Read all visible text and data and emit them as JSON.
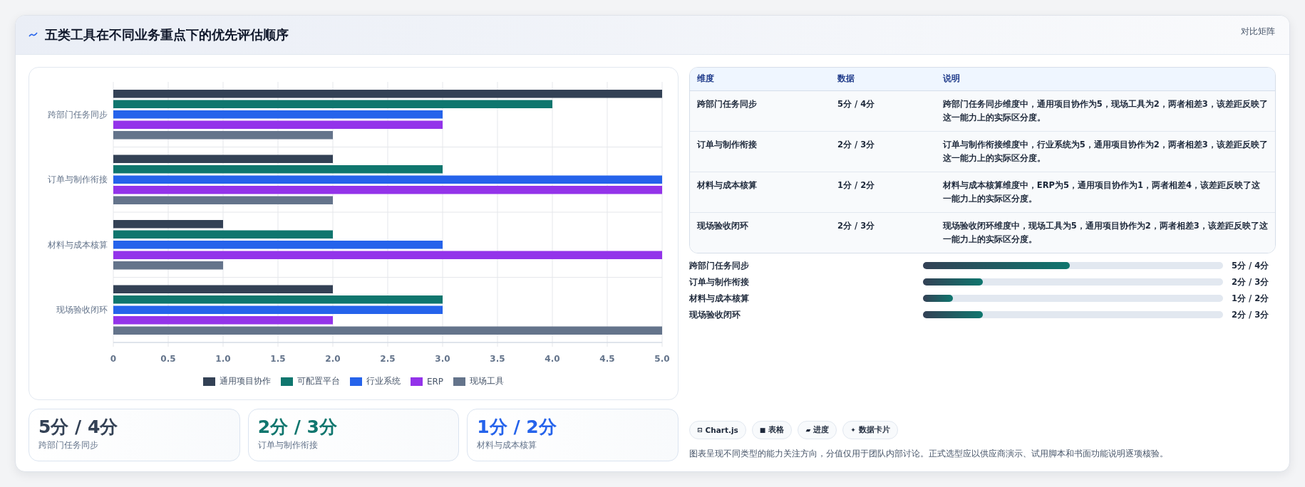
{
  "header": {
    "title": "五类工具在不同业务重点下的优先评估顺序",
    "action": "对比矩阵"
  },
  "chart": {
    "chart_data": {
      "type": "bar",
      "orientation": "horizontal",
      "categories": [
        "跨部门任务同步",
        "订单与制作衔接",
        "材料与成本核算",
        "现场验收闭环"
      ],
      "series": [
        {
          "name": "通用项目协作",
          "color": "#334155",
          "values": [
            5,
            2,
            1,
            2
          ]
        },
        {
          "name": "可配置平台",
          "color": "#0f766e",
          "values": [
            4,
            3,
            2,
            3
          ]
        },
        {
          "name": "行业系统",
          "color": "#2563eb",
          "values": [
            3,
            5,
            3,
            3
          ]
        },
        {
          "name": "ERP",
          "color": "#9333ea",
          "values": [
            3,
            5,
            5,
            2
          ]
        },
        {
          "name": "现场工具",
          "color": "#64748b",
          "values": [
            2,
            2,
            1,
            5
          ]
        }
      ],
      "xlim": [
        0,
        5
      ],
      "grid": true,
      "xticks": [
        {
          "value": 0,
          "label": "0"
        },
        {
          "value": 0.5,
          "label": "0.5"
        },
        {
          "value": 1,
          "label": "1.0"
        },
        {
          "value": 1.5,
          "label": "1.5"
        },
        {
          "value": 2,
          "label": "2.0"
        },
        {
          "value": 2.5,
          "label": "2.5"
        },
        {
          "value": 3,
          "label": "3.0"
        },
        {
          "value": 3.5,
          "label": "3.5"
        },
        {
          "value": 4,
          "label": "4.0"
        },
        {
          "value": 4.5,
          "label": "4.5"
        },
        {
          "value": 5,
          "label": "5.0"
        }
      ]
    }
  },
  "stats": [
    {
      "value": "5分 / 4分",
      "label": "跨部门任务同步",
      "color": "#334155"
    },
    {
      "value": "2分 / 3分",
      "label": "订单与制作衔接",
      "color": "#0f766e"
    },
    {
      "value": "1分 / 2分",
      "label": "材料与成本核算",
      "color": "#2563eb"
    }
  ],
  "table": {
    "columns": [
      "维度",
      "数据",
      "说明"
    ],
    "rows": [
      [
        "跨部门任务同步",
        "5分 / 4分",
        "跨部门任务同步维度中，通用项目协作为5，现场工具为2，两者相差3，该差距反映了这一能力上的实际区分度。"
      ],
      [
        "订单与制作衔接",
        "2分 / 3分",
        "订单与制作衔接维度中，行业系统为5，通用项目协作为2，两者相差3，该差距反映了这一能力上的实际区分度。"
      ],
      [
        "材料与成本核算",
        "1分 / 2分",
        "材料与成本核算维度中，ERP为5，通用项目协作为1，两者相差4，该差距反映了这一能力上的实际区分度。"
      ],
      [
        "现场验收闭环",
        "2分 / 3分",
        "现场验收闭环维度中，现场工具为5，通用项目协作为2，两者相差3，该差距反映了这一能力上的实际区分度。"
      ]
    ]
  },
  "progress": [
    {
      "label": "跨部门任务同步",
      "level": 0.49,
      "reading": "5分 / 4分"
    },
    {
      "label": "订单与制作衔接",
      "level": 0.2,
      "reading": "2分 / 3分"
    },
    {
      "label": "材料与成本核算",
      "level": 0.1,
      "reading": "1分 / 2分"
    },
    {
      "label": "现场验收闭环",
      "level": 0.2,
      "reading": "2分 / 3分"
    }
  ],
  "chips": [
    {
      "icon": "⊟",
      "label": "Chart.js"
    },
    {
      "icon": "■",
      "label": "表格"
    },
    {
      "icon": "▰",
      "label": "进度"
    },
    {
      "icon": "✦",
      "label": "数据卡片"
    }
  ],
  "note": "图表呈现不同类型的能力关注方向，分值仅用于团队内部讨论。正式选型应以供应商演示、试用脚本和书面功能说明逐项核验。"
}
